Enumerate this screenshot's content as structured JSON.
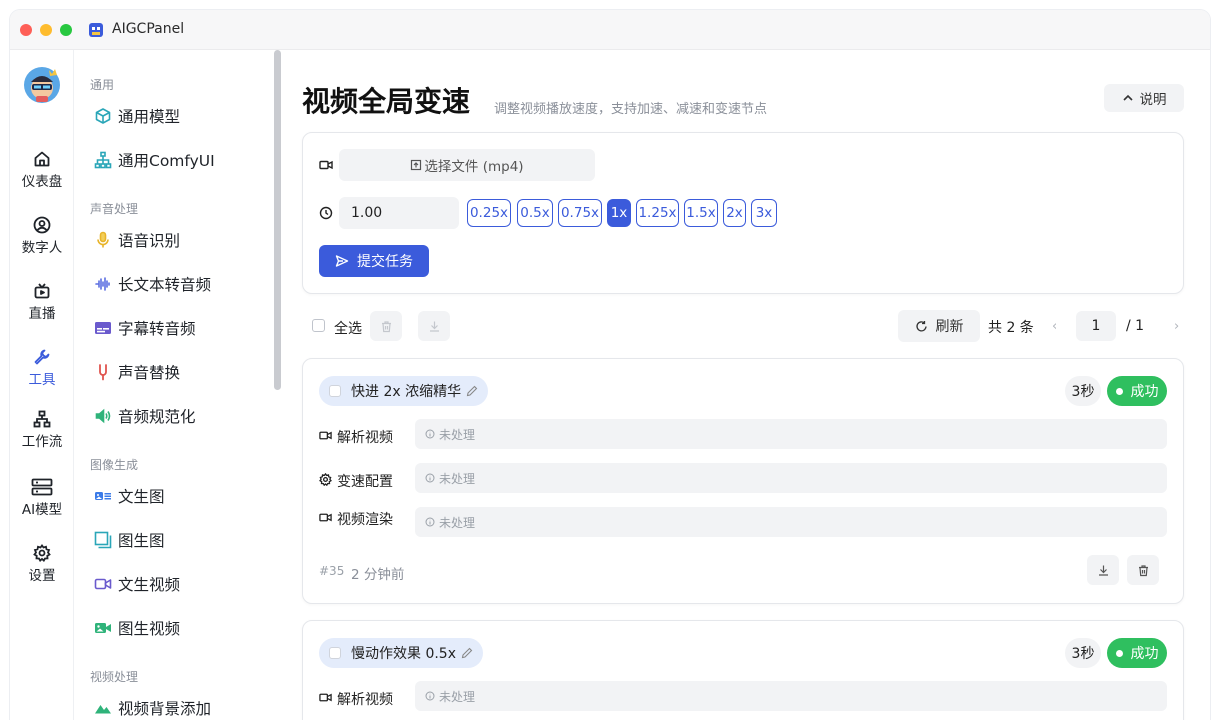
{
  "app": {
    "title": "AIGCPanel"
  },
  "rail": [
    {
      "label": "仪表盘",
      "icon": "home-icon",
      "active": false
    },
    {
      "label": "数字人",
      "icon": "user-circle-icon",
      "active": false
    },
    {
      "label": "直播",
      "icon": "tv-icon",
      "active": false
    },
    {
      "label": "工具",
      "icon": "wrench-icon",
      "active": true
    },
    {
      "label": "工作流",
      "icon": "workflow-icon",
      "active": false
    },
    {
      "label": "AI模型",
      "icon": "server-icon",
      "active": false
    },
    {
      "label": "设置",
      "icon": "gear-icon",
      "active": false
    }
  ],
  "menu": {
    "groups": [
      "通用",
      "声音处理",
      "图像生成",
      "视频处理"
    ],
    "items": [
      {
        "label": "通用模型",
        "icon": "cube-icon"
      },
      {
        "label": "通用ComfyUI",
        "icon": "sitemap-icon"
      },
      {
        "label": "语音识别",
        "icon": "microphone-icon"
      },
      {
        "label": "长文本转音频",
        "icon": "waveform-icon"
      },
      {
        "label": "字幕转音频",
        "icon": "subtitle-icon"
      },
      {
        "label": "声音替换",
        "icon": "tuning-fork-icon"
      },
      {
        "label": "音频规范化",
        "icon": "speaker-icon"
      },
      {
        "label": "文生图",
        "icon": "text-image-icon"
      },
      {
        "label": "图生图",
        "icon": "image-copy-icon"
      },
      {
        "label": "文生视频",
        "icon": "video-camera-icon"
      },
      {
        "label": "图生视频",
        "icon": "image-video-icon"
      },
      {
        "label": "视频背景添加",
        "icon": "landscape-icon"
      }
    ]
  },
  "page": {
    "title": "视频全局变速",
    "subtitle": "调整视频播放速度，支持加速、减速和变速节点",
    "help_label": "说明"
  },
  "form": {
    "file_button": "选择文件 (mp4)",
    "speed_value": "1.00",
    "speed_chips": [
      "0.25x",
      "0.5x",
      "0.75x",
      "1x",
      "1.25x",
      "1.5x",
      "2x",
      "3x"
    ],
    "active_chip": "1x",
    "submit_label": "提交任务"
  },
  "toolbar": {
    "select_all": "全选",
    "refresh": "刷新",
    "total": "共 2 条",
    "page_current": "1",
    "page_total": "/ 1"
  },
  "tasks": [
    {
      "title": "快进 2x 浓缩精华",
      "duration": "3秒",
      "status": "成功",
      "steps": [
        {
          "label": "解析视频",
          "value": "未处理",
          "icon": "video-icon"
        },
        {
          "label": "变速配置",
          "value": "未处理",
          "icon": "gear-icon"
        },
        {
          "label": "视频渲染",
          "value": "未处理",
          "icon": "video-icon"
        }
      ],
      "id": "#35",
      "time": "2 分钟前"
    },
    {
      "title": "慢动作效果 0.5x",
      "duration": "3秒",
      "status": "成功",
      "steps": [
        {
          "label": "解析视频",
          "value": "未处理",
          "icon": "video-icon"
        }
      ]
    }
  ],
  "colors": {
    "accent": "#3b5bdb",
    "success": "#2fbf5f",
    "muted_bg": "#f2f3f5"
  }
}
